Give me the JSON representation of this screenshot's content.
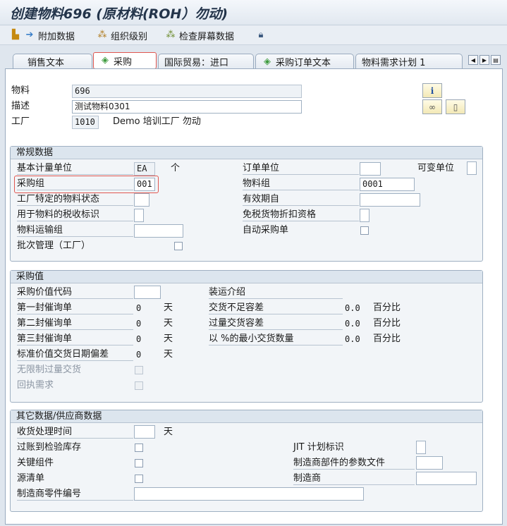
{
  "title": "创建物料696 (原材料(ROH）勿动)",
  "toolbar": {
    "additional_data": "附加数据",
    "org_levels": "组织级别",
    "check_screen": "检查屏幕数据"
  },
  "tabs": [
    "销售文本",
    "采购",
    "国际贸易：进口",
    "采购订单文本",
    "物料需求计划 1"
  ],
  "header": {
    "material_label": "物料",
    "material_value": "696",
    "desc_label": "描述",
    "desc_value": "测试物料0301",
    "plant_label": "工厂",
    "plant_value": "1010",
    "plant_name": "Demo 培训工厂 勿动"
  },
  "general": {
    "title": "常规数据",
    "base_uom_label": "基本计量单位",
    "base_uom_value": "EA",
    "base_uom_text": "个",
    "order_unit_label": "订单单位",
    "var_unit_label": "可变单位",
    "purch_group_label": "采购组",
    "purch_group_value": "001",
    "mat_group_label": "物料组",
    "mat_group_value": "0001",
    "plant_status_label": "工厂特定的物料状态",
    "valid_from_label": "有效期自",
    "tax_ind_label": "用于物料的税收标识",
    "tax_free_label": "免税货物折扣资格",
    "transport_label": "物料运输组",
    "auto_po_label": "自动采购单",
    "batch_label": "批次管理（工厂）"
  },
  "purch_values": {
    "title": "采购值",
    "key_label": "采购价值代码",
    "ship_instr_label": "装运介绍",
    "rem1_label": "第一封催询单",
    "rem1_value": "0",
    "rem1_unit": "天",
    "underdel_label": "交货不足容差",
    "underdel_value": "0.0",
    "underdel_unit": "百分比",
    "rem2_label": "第二封催询单",
    "rem2_value": "0",
    "rem2_unit": "天",
    "overdel_label": "过量交货容差",
    "overdel_value": "0.0",
    "overdel_unit": "百分比",
    "rem3_label": "第三封催询单",
    "rem3_value": "0",
    "rem3_unit": "天",
    "minqty_label": "以 %的最小交货数量",
    "minqty_value": "0.0",
    "minqty_unit": "百分比",
    "std_dev_label": "标准价值交货日期偏差",
    "std_dev_value": "0",
    "std_dev_unit": "天",
    "unlimited_label": "无限制过量交货",
    "ack_label": "回执需求"
  },
  "other": {
    "title": "其它数据/供应商数据",
    "gr_time_label": "收货处理时间",
    "gr_time_unit": "天",
    "post_insp_label": "过账到检验库存",
    "jit_label": "JIT 计划标识",
    "critical_label": "关键组件",
    "mpn_profile_label": "制造商部件的参数文件",
    "source_list_label": "源清单",
    "manufacturer_label": "制造商",
    "mfr_part_label": "制造商零件编号"
  }
}
